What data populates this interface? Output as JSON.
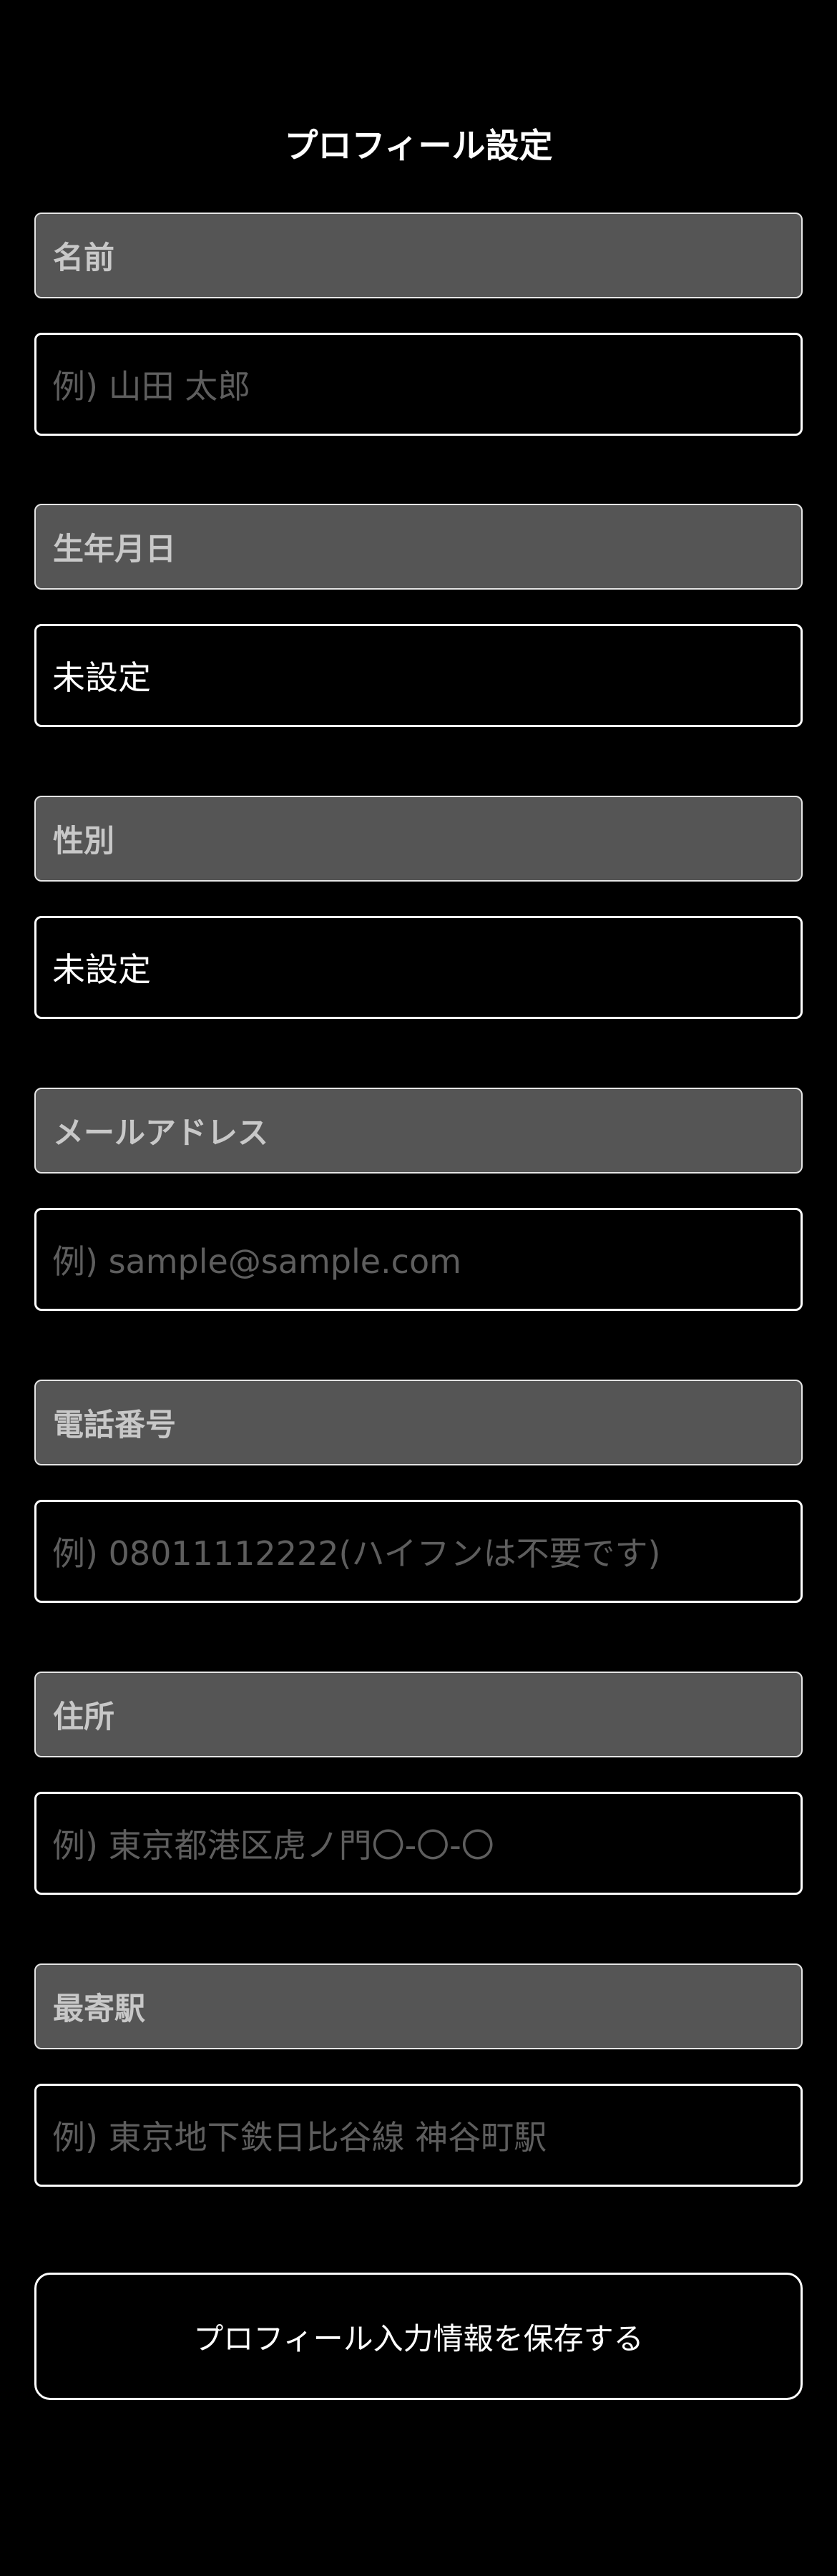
{
  "page": {
    "title": "プロフィール設定"
  },
  "fields": [
    {
      "label": "名前",
      "value": "",
      "placeholder": "例) 山田 太郎"
    },
    {
      "label": "生年月日",
      "value": "未設定",
      "placeholder": ""
    },
    {
      "label": "性別",
      "value": "未設定",
      "placeholder": ""
    },
    {
      "label": "メールアドレス",
      "value": "",
      "placeholder": "例) sample@sample.com"
    },
    {
      "label": "電話番号",
      "value": "",
      "placeholder": "例) 08011112222(ハイフンは不要です)"
    },
    {
      "label": "住所",
      "value": "",
      "placeholder": "例) 東京都港区虎ノ門〇-〇-〇"
    },
    {
      "label": "最寄駅",
      "value": "",
      "placeholder": "例) 東京地下鉄日比谷線 神谷町駅"
    }
  ],
  "actions": {
    "save_label": "プロフィール入力情報を保存する"
  },
  "colors": {
    "background": "#000000",
    "label_background": "#555555",
    "label_text": "#c8c8c8",
    "placeholder_text": "#5e5e5e",
    "border": "#ffffff"
  }
}
